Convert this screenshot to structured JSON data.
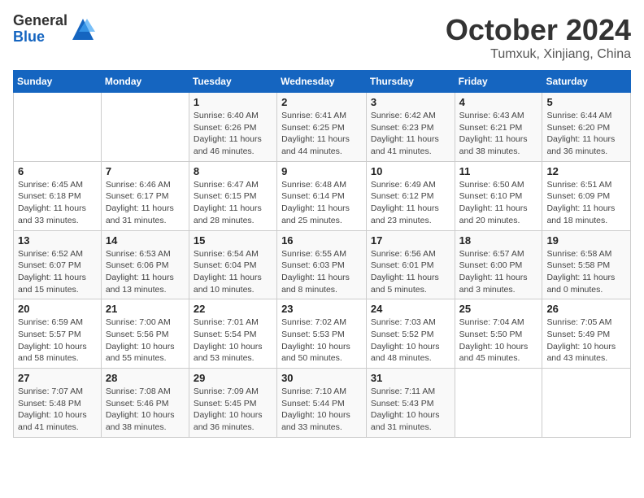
{
  "logo": {
    "general": "General",
    "blue": "Blue"
  },
  "header": {
    "month": "October 2024",
    "location": "Tumxuk, Xinjiang, China"
  },
  "weekdays": [
    "Sunday",
    "Monday",
    "Tuesday",
    "Wednesday",
    "Thursday",
    "Friday",
    "Saturday"
  ],
  "weeks": [
    [
      {
        "day": "",
        "info": ""
      },
      {
        "day": "",
        "info": ""
      },
      {
        "day": "1",
        "info": "Sunrise: 6:40 AM\nSunset: 6:26 PM\nDaylight: 11 hours and 46 minutes."
      },
      {
        "day": "2",
        "info": "Sunrise: 6:41 AM\nSunset: 6:25 PM\nDaylight: 11 hours and 44 minutes."
      },
      {
        "day": "3",
        "info": "Sunrise: 6:42 AM\nSunset: 6:23 PM\nDaylight: 11 hours and 41 minutes."
      },
      {
        "day": "4",
        "info": "Sunrise: 6:43 AM\nSunset: 6:21 PM\nDaylight: 11 hours and 38 minutes."
      },
      {
        "day": "5",
        "info": "Sunrise: 6:44 AM\nSunset: 6:20 PM\nDaylight: 11 hours and 36 minutes."
      }
    ],
    [
      {
        "day": "6",
        "info": "Sunrise: 6:45 AM\nSunset: 6:18 PM\nDaylight: 11 hours and 33 minutes."
      },
      {
        "day": "7",
        "info": "Sunrise: 6:46 AM\nSunset: 6:17 PM\nDaylight: 11 hours and 31 minutes."
      },
      {
        "day": "8",
        "info": "Sunrise: 6:47 AM\nSunset: 6:15 PM\nDaylight: 11 hours and 28 minutes."
      },
      {
        "day": "9",
        "info": "Sunrise: 6:48 AM\nSunset: 6:14 PM\nDaylight: 11 hours and 25 minutes."
      },
      {
        "day": "10",
        "info": "Sunrise: 6:49 AM\nSunset: 6:12 PM\nDaylight: 11 hours and 23 minutes."
      },
      {
        "day": "11",
        "info": "Sunrise: 6:50 AM\nSunset: 6:10 PM\nDaylight: 11 hours and 20 minutes."
      },
      {
        "day": "12",
        "info": "Sunrise: 6:51 AM\nSunset: 6:09 PM\nDaylight: 11 hours and 18 minutes."
      }
    ],
    [
      {
        "day": "13",
        "info": "Sunrise: 6:52 AM\nSunset: 6:07 PM\nDaylight: 11 hours and 15 minutes."
      },
      {
        "day": "14",
        "info": "Sunrise: 6:53 AM\nSunset: 6:06 PM\nDaylight: 11 hours and 13 minutes."
      },
      {
        "day": "15",
        "info": "Sunrise: 6:54 AM\nSunset: 6:04 PM\nDaylight: 11 hours and 10 minutes."
      },
      {
        "day": "16",
        "info": "Sunrise: 6:55 AM\nSunset: 6:03 PM\nDaylight: 11 hours and 8 minutes."
      },
      {
        "day": "17",
        "info": "Sunrise: 6:56 AM\nSunset: 6:01 PM\nDaylight: 11 hours and 5 minutes."
      },
      {
        "day": "18",
        "info": "Sunrise: 6:57 AM\nSunset: 6:00 PM\nDaylight: 11 hours and 3 minutes."
      },
      {
        "day": "19",
        "info": "Sunrise: 6:58 AM\nSunset: 5:58 PM\nDaylight: 11 hours and 0 minutes."
      }
    ],
    [
      {
        "day": "20",
        "info": "Sunrise: 6:59 AM\nSunset: 5:57 PM\nDaylight: 10 hours and 58 minutes."
      },
      {
        "day": "21",
        "info": "Sunrise: 7:00 AM\nSunset: 5:56 PM\nDaylight: 10 hours and 55 minutes."
      },
      {
        "day": "22",
        "info": "Sunrise: 7:01 AM\nSunset: 5:54 PM\nDaylight: 10 hours and 53 minutes."
      },
      {
        "day": "23",
        "info": "Sunrise: 7:02 AM\nSunset: 5:53 PM\nDaylight: 10 hours and 50 minutes."
      },
      {
        "day": "24",
        "info": "Sunrise: 7:03 AM\nSunset: 5:52 PM\nDaylight: 10 hours and 48 minutes."
      },
      {
        "day": "25",
        "info": "Sunrise: 7:04 AM\nSunset: 5:50 PM\nDaylight: 10 hours and 45 minutes."
      },
      {
        "day": "26",
        "info": "Sunrise: 7:05 AM\nSunset: 5:49 PM\nDaylight: 10 hours and 43 minutes."
      }
    ],
    [
      {
        "day": "27",
        "info": "Sunrise: 7:07 AM\nSunset: 5:48 PM\nDaylight: 10 hours and 41 minutes."
      },
      {
        "day": "28",
        "info": "Sunrise: 7:08 AM\nSunset: 5:46 PM\nDaylight: 10 hours and 38 minutes."
      },
      {
        "day": "29",
        "info": "Sunrise: 7:09 AM\nSunset: 5:45 PM\nDaylight: 10 hours and 36 minutes."
      },
      {
        "day": "30",
        "info": "Sunrise: 7:10 AM\nSunset: 5:44 PM\nDaylight: 10 hours and 33 minutes."
      },
      {
        "day": "31",
        "info": "Sunrise: 7:11 AM\nSunset: 5:43 PM\nDaylight: 10 hours and 31 minutes."
      },
      {
        "day": "",
        "info": ""
      },
      {
        "day": "",
        "info": ""
      }
    ]
  ]
}
